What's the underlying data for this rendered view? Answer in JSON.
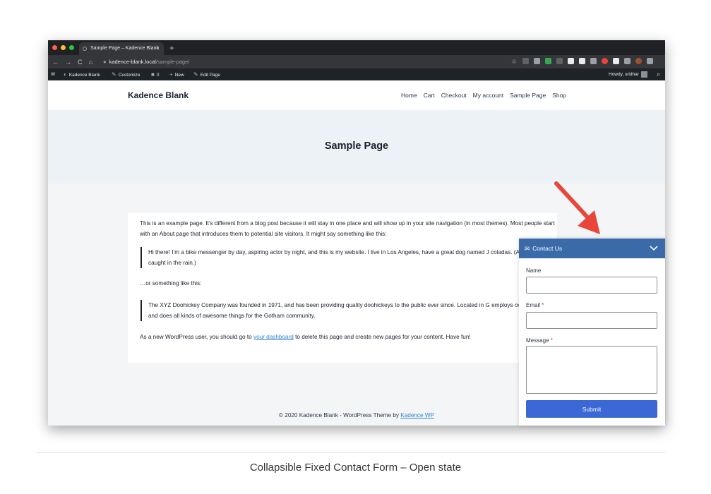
{
  "browser": {
    "tab_title": "Sample Page – Kadence Blank",
    "tab_close": "×",
    "new_tab": "+",
    "nav_icons": [
      "←",
      "→",
      "C",
      "⌂"
    ],
    "url_host": "kadence-blank.local",
    "url_path": "/sample-page/",
    "star": "☆"
  },
  "admin_bar": {
    "wp_logo": "W",
    "site_name": "Kadence Blank",
    "customize": "Customize",
    "comments_count": "0",
    "new": "New",
    "edit_page": "Edit Page",
    "howdy": "Howdy, sridhar",
    "search_icon": "⌕"
  },
  "site": {
    "logo": "Kadence Blank",
    "nav": [
      "Home",
      "Cart",
      "Checkout",
      "My account",
      "Sample Page",
      "Shop"
    ],
    "page_title": "Sample Page",
    "content": {
      "p1": "This is an example page. It’s different from a blog post because it will stay in one place and will show up in your site navigation (in most themes). Most people start with an About page that introduces them to potential site visitors. It might say something like this:",
      "quote1": "Hi there! I’m a bike messenger by day, aspiring actor by night, and this is my website. I live in Los Angeles, have a great dog named J coladas. (And gettin’ caught in the rain.)",
      "p2": "…or something like this:",
      "quote2": "The XYZ Doohickey Company was founded in 1971, and has been providing quality doohickeys to the public ever since. Located in G employs over 2,000 people and does all kinds of awesome things for the Gotham community.",
      "p3_before": "As a new WordPress user, you should go to ",
      "p3_link": "your dashboard",
      "p3_after": " to delete this page and create new pages for your content. Have fun!"
    },
    "footer_text": "© 2020 Kadence Blank - WordPress Theme by ",
    "footer_link": "Kadence WP"
  },
  "widget": {
    "title": "Contact Us",
    "name_label": "Name",
    "email_label": "Email",
    "message_label": "Message",
    "required_mark": "*",
    "submit": "Submit"
  },
  "caption": "Collapsible Fixed Contact Form – Open state",
  "colors": {
    "widget_header": "#3a6aa8",
    "submit": "#3b68d6",
    "arrow": "#e8463a",
    "link": "#3182ce"
  }
}
